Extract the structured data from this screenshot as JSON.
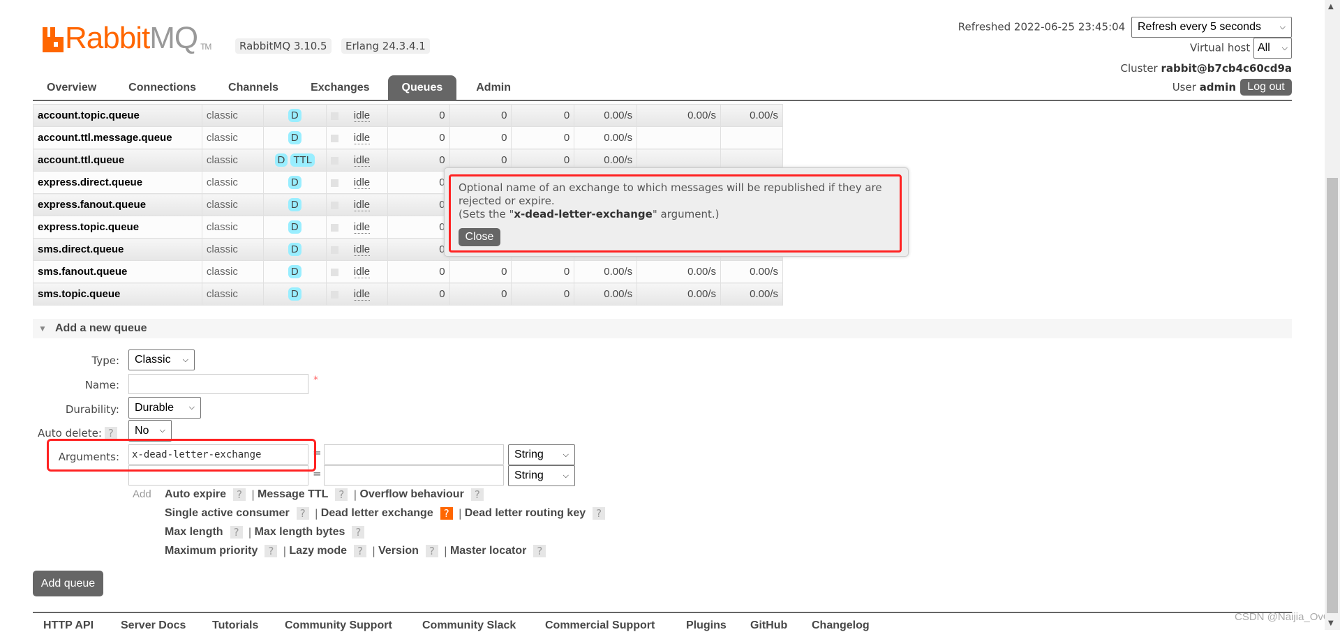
{
  "header": {
    "logo_text_orange": "Rabbit",
    "logo_text_gray": "MQ",
    "logo_tm": "TM",
    "brand_color": "#ff6600",
    "version_rabbit": "RabbitMQ 3.10.5",
    "version_erlang": "Erlang 24.3.4.1",
    "refreshed": "Refreshed 2022-06-25 23:45:04",
    "refresh_select": "Refresh every 5 seconds",
    "vhost_label": "Virtual host",
    "vhost_select": "All",
    "cluster_label": "Cluster",
    "cluster_name": "rabbit@b7cb4c60cd9a",
    "user_label": "User",
    "user_name": "admin",
    "logout": "Log out"
  },
  "tabs": [
    {
      "label": "Overview"
    },
    {
      "label": "Connections"
    },
    {
      "label": "Channels"
    },
    {
      "label": "Exchanges"
    },
    {
      "label": "Queues",
      "active": true
    },
    {
      "label": "Admin"
    }
  ],
  "queues": [
    {
      "name": "account.topic.queue",
      "type": "classic",
      "features": [
        "D"
      ],
      "state": "idle",
      "ready": "0",
      "unacked": "0",
      "total": "0",
      "incoming": "0.00/s",
      "deliver": "0.00/s",
      "ack": "0.00/s"
    },
    {
      "name": "account.ttl.message.queue",
      "type": "classic",
      "features": [
        "D"
      ],
      "state": "idle",
      "ready": "0",
      "unacked": "0",
      "total": "0",
      "incoming": "0.00/s",
      "deliver": "",
      "ack": ""
    },
    {
      "name": "account.ttl.queue",
      "type": "classic",
      "features": [
        "D",
        "TTL"
      ],
      "state": "idle",
      "ready": "0",
      "unacked": "0",
      "total": "0",
      "incoming": "0.00/s",
      "deliver": "",
      "ack": ""
    },
    {
      "name": "express.direct.queue",
      "type": "classic",
      "features": [
        "D"
      ],
      "state": "idle",
      "ready": "0",
      "unacked": "",
      "total": "",
      "incoming": "",
      "deliver": "",
      "ack": ""
    },
    {
      "name": "express.fanout.queue",
      "type": "classic",
      "features": [
        "D"
      ],
      "state": "idle",
      "ready": "0",
      "unacked": "",
      "total": "",
      "incoming": "",
      "deliver": "",
      "ack": ""
    },
    {
      "name": "express.topic.queue",
      "type": "classic",
      "features": [
        "D"
      ],
      "state": "idle",
      "ready": "0",
      "unacked": "",
      "total": "",
      "incoming": "",
      "deliver": "",
      "ack": ""
    },
    {
      "name": "sms.direct.queue",
      "type": "classic",
      "features": [
        "D"
      ],
      "state": "idle",
      "ready": "0",
      "unacked": "",
      "total": "",
      "incoming": "",
      "deliver": "",
      "ack": ""
    },
    {
      "name": "sms.fanout.queue",
      "type": "classic",
      "features": [
        "D"
      ],
      "state": "idle",
      "ready": "0",
      "unacked": "0",
      "total": "0",
      "incoming": "0.00/s",
      "deliver": "0.00/s",
      "ack": "0.00/s"
    },
    {
      "name": "sms.topic.queue",
      "type": "classic",
      "features": [
        "D"
      ],
      "state": "idle",
      "ready": "0",
      "unacked": "0",
      "total": "0",
      "incoming": "0.00/s",
      "deliver": "0.00/s",
      "ack": "0.00/s"
    }
  ],
  "tooltip": {
    "line1": "Optional name of an exchange to which messages will be republished if they are rejected or expire.",
    "line2_pre": "(Sets the \"",
    "line2_bold": "x-dead-letter-exchange",
    "line2_post": "\" argument.)",
    "close": "Close"
  },
  "add_queue": {
    "section_title": "Add a new queue",
    "type_label": "Type:",
    "type_value": "Classic",
    "name_label": "Name:",
    "name_value": "",
    "required_mark": "*",
    "durability_label": "Durability:",
    "durability_value": "Durable",
    "auto_delete_label": "Auto delete:",
    "auto_delete_value": "No",
    "help": "?",
    "arguments_label": "Arguments:",
    "arguments": [
      {
        "key": "x-dead-letter-exchange",
        "value": "",
        "type": "String"
      },
      {
        "key": "",
        "value": "",
        "type": "String"
      }
    ],
    "eq": "=",
    "add_label": "Add",
    "sep": "|",
    "arg_links": [
      [
        "Auto expire",
        "Message TTL",
        "Overflow behaviour"
      ],
      [
        "Single active consumer",
        "Dead letter exchange",
        "Dead letter routing key"
      ],
      [
        "Max length",
        "Max length bytes"
      ],
      [
        "Maximum priority",
        "Lazy mode",
        "Version",
        "Master locator"
      ]
    ],
    "highlighted_link": "Dead letter exchange",
    "submit": "Add queue"
  },
  "footer": [
    "HTTP API",
    "Server Docs",
    "Tutorials",
    "Community Support",
    "Community Slack",
    "Commercial Support",
    "Plugins",
    "GitHub",
    "Changelog"
  ],
  "watermark": "CSDN @Naijia_OvO"
}
